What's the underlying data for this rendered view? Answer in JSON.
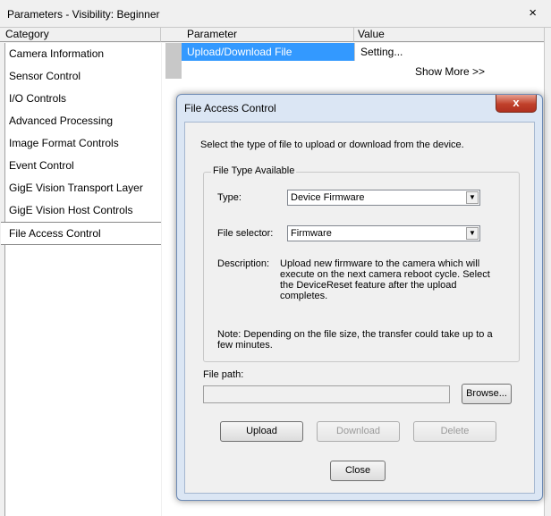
{
  "panel": {
    "title": "Parameters - Visibility: Beginner",
    "close_glyph": "×",
    "columns": {
      "category": "Category",
      "parameter": "Parameter",
      "value": "Value"
    }
  },
  "categories": [
    "Camera Information",
    "Sensor Control",
    "I/O Controls",
    "Advanced Processing",
    "Image Format Controls",
    "Event Control",
    "GigE Vision Transport Layer",
    "GigE Vision Host Controls",
    "File Access Control"
  ],
  "selected_category": "File Access Control",
  "parameter_row": {
    "name": "Upload/Download File",
    "value": "Setting..."
  },
  "show_more": "Show More >>",
  "dialog": {
    "title": "File Access Control",
    "close_glyph": "x",
    "intro": "Select the type of file to upload or download from the device.",
    "group_title": "File Type Available",
    "type_label": "Type:",
    "type_value": "Device Firmware",
    "selector_label": "File selector:",
    "selector_value": "Firmware",
    "description_label": "Description:",
    "description_text": "Upload new firmware to the camera which will execute on the next camera reboot cycle. Select the DeviceReset feature after the upload completes.",
    "note": "Note: Depending on the file size, the transfer could take up to a few minutes.",
    "file_path_label": "File path:",
    "file_path_value": "",
    "browse_label": "Browse...",
    "upload_label": "Upload",
    "download_label": "Download",
    "delete_label": "Delete",
    "close_label": "Close"
  }
}
